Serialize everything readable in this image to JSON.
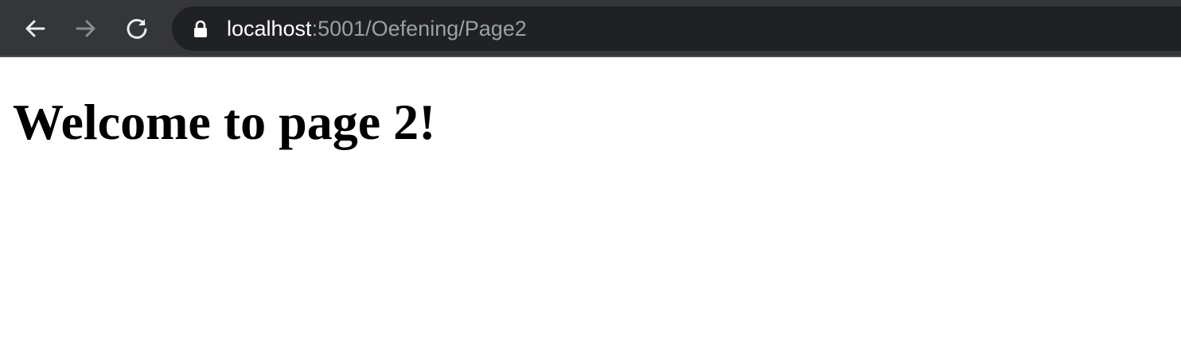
{
  "browser": {
    "toolbar_color": "#35363a",
    "omnibox_color": "#202124",
    "back_icon": "arrow-left-icon",
    "forward_icon": "arrow-right-icon",
    "reload_icon": "reload-icon",
    "lock_icon": "lock-icon",
    "address": {
      "host": "localhost",
      "path": ":5001/Oefening/Page2"
    }
  },
  "page": {
    "heading": "Welcome to page 2!"
  }
}
